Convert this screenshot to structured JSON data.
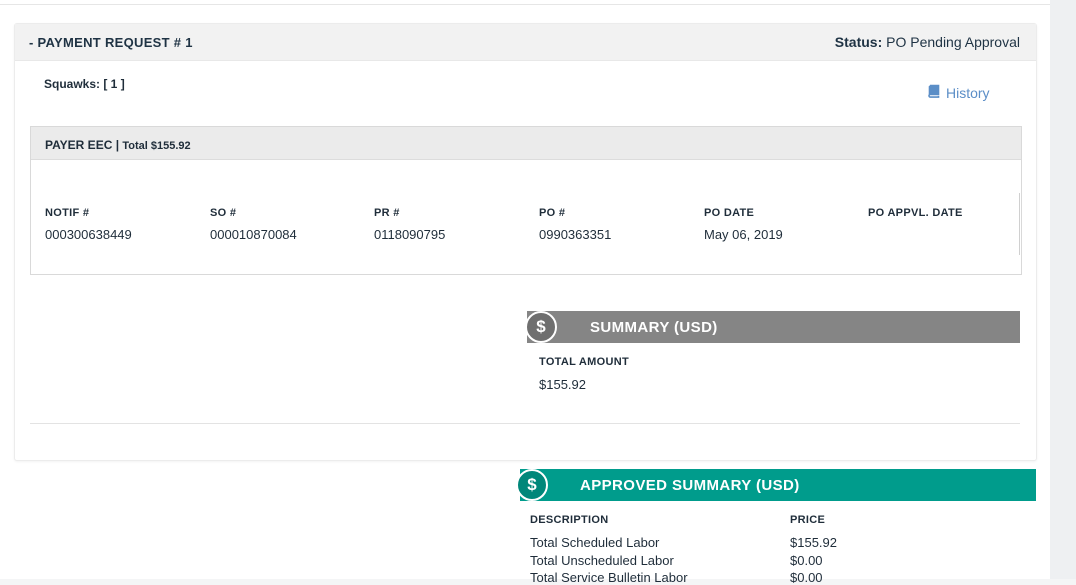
{
  "payment_request": {
    "title": "- PAYMENT REQUEST # 1",
    "status_label": "Status:",
    "status_value": "PO Pending Approval",
    "squawks": "Squawks: [ 1 ]",
    "history_label": "History"
  },
  "payer": {
    "name": "PAYER EEC",
    "separator": " | ",
    "total": "Total $155.92",
    "columns": [
      {
        "header": "NOTIF #",
        "value": "000300638449"
      },
      {
        "header": "SO #",
        "value": "000010870084"
      },
      {
        "header": "PR #",
        "value": "0118090795"
      },
      {
        "header": "PO #",
        "value": "0990363351"
      },
      {
        "header": "PO DATE",
        "value": "May 06, 2019"
      },
      {
        "header": "PO APPVL. DATE",
        "value": ""
      }
    ]
  },
  "summary": {
    "icon_glyph": "$",
    "title": "SUMMARY (USD)",
    "total_label": "TOTAL AMOUNT",
    "total_value": "$155.92"
  },
  "approved_summary": {
    "icon_glyph": "$",
    "title": "APPROVED SUMMARY (USD)",
    "desc_header": "DESCRIPTION",
    "price_header": "PRICE",
    "rows": [
      {
        "description": "Total Scheduled Labor",
        "price": "$155.92"
      },
      {
        "description": "Total Unscheduled Labor",
        "price": "$0.00"
      },
      {
        "description": "Total Service Bulletin Labor",
        "price": "$0.00"
      }
    ]
  },
  "colors": {
    "summary_bar": "#858585",
    "approved_bar": "#009c8c",
    "link": "#5b8ec7"
  },
  "icons": {
    "history": "book-icon",
    "summary": "dollar-icon",
    "approved": "dollar-icon"
  }
}
